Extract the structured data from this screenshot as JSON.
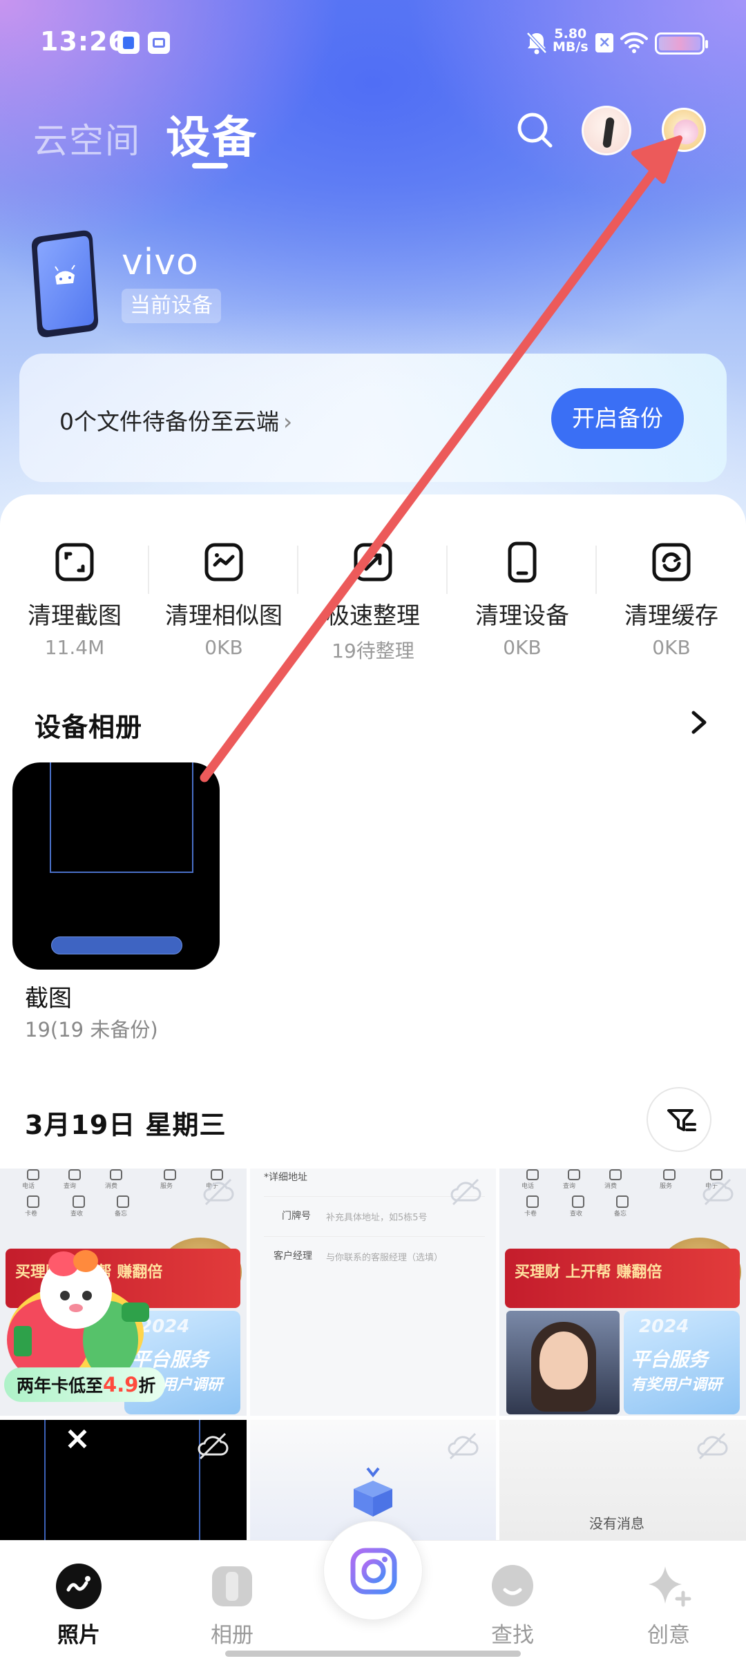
{
  "status_bar": {
    "time": "13:26",
    "net_speed_value": "5.80",
    "net_speed_unit": "MB/s",
    "icons": [
      "app-badge-icon",
      "app-store-icon",
      "mute-bell-icon",
      "x-app-icon",
      "wifi-icon",
      "battery-icon"
    ]
  },
  "header": {
    "tab_cloud": "云空间",
    "tab_device": "设备",
    "icons": [
      "search-icon",
      "avatar",
      "avatar"
    ]
  },
  "device": {
    "name": "vivo",
    "badge": "当前设备"
  },
  "backup": {
    "text": "0个文件待备份至云端",
    "chevron": "›",
    "button": "开启备份"
  },
  "tools": [
    {
      "label": "清理截图",
      "sub": "11.4M",
      "icon": "crop-icon"
    },
    {
      "label": "清理相似图",
      "sub": "0KB",
      "icon": "similar-image-icon"
    },
    {
      "label": "极速整理",
      "sub": "19待整理",
      "icon": "quick-organize-icon"
    },
    {
      "label": "清理设备",
      "sub": "0KB",
      "icon": "phone-icon"
    },
    {
      "label": "清理缓存",
      "sub": "0KB",
      "icon": "refresh-icon"
    }
  ],
  "albums_section": {
    "title": "设备相册",
    "album": {
      "name": "截图",
      "count": "19(19 未备份)"
    }
  },
  "timeline": {
    "date": "3月19日 星期三",
    "photo_texts": {
      "form_label_address": "*详细地址",
      "form_label_door": "门牌号",
      "form_label_manager": "客户经理",
      "form_hint_door": "补充具体地址，如5栋5号",
      "form_hint_manager": "与你联系的客服经理（选填）",
      "banner_red": "买理财 上开帮 赚翻倍",
      "banner_blue_year": "2024",
      "banner_blue_line1": "平台服务",
      "banner_blue_line2": "有奖用户调研",
      "no_message": "没有消息"
    }
  },
  "promo": {
    "prefix": "两年卡低至",
    "discount": "4.9",
    "suffix": "折"
  },
  "tabbar": {
    "items": [
      {
        "label": "照片",
        "icon": "photos-icon",
        "active": true
      },
      {
        "label": "相册",
        "icon": "album-icon",
        "active": false
      },
      {
        "label": "",
        "icon": "camera-icon",
        "active": false
      },
      {
        "label": "查找",
        "icon": "search-face-icon",
        "active": false
      },
      {
        "label": "创意",
        "icon": "sparkle-icon",
        "active": false
      }
    ]
  },
  "colors": {
    "accent": "#3a6ff5",
    "annotation_arrow": "#ec5a5a",
    "promo_red": "#ff4a3d"
  }
}
